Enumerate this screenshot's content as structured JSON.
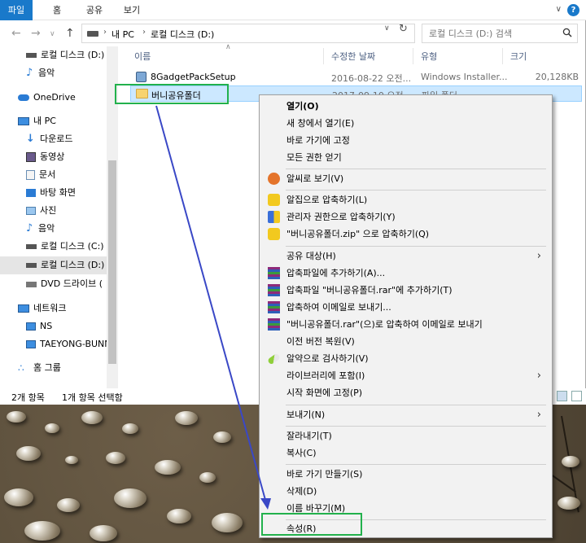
{
  "ribbon": {
    "tabs": [
      "파일",
      "홈",
      "공유",
      "보기"
    ],
    "help": "?"
  },
  "address": {
    "crumbs": [
      "내 PC",
      "로컬 디스크 (D:)"
    ],
    "search_placeholder": "로컬 디스크 (D:) 검색"
  },
  "nav": {
    "items": [
      {
        "label": "로컬 디스크 (D:)",
        "icon": "drive-icon"
      },
      {
        "label": "음악",
        "icon": "music-icon"
      },
      {
        "label": "OneDrive",
        "icon": "onedrive-icon"
      },
      {
        "label": "내 PC",
        "icon": "pc-icon"
      },
      {
        "label": "다운로드",
        "icon": "download-icon"
      },
      {
        "label": "동영상",
        "icon": "video-icon"
      },
      {
        "label": "문서",
        "icon": "document-icon"
      },
      {
        "label": "바탕 화면",
        "icon": "desktop-icon"
      },
      {
        "label": "사진",
        "icon": "picture-icon"
      },
      {
        "label": "음악",
        "icon": "music-icon"
      },
      {
        "label": "로컬 디스크 (C:)",
        "icon": "drive-icon"
      },
      {
        "label": "로컬 디스크 (D:)",
        "icon": "drive-icon"
      },
      {
        "label": "DVD 드라이브 (",
        "icon": "dvd-icon"
      },
      {
        "label": "네트워크",
        "icon": "network-icon"
      },
      {
        "label": "NS",
        "icon": "computer-icon"
      },
      {
        "label": "TAEYONG-BUNN",
        "icon": "computer-icon"
      },
      {
        "label": "홈 그룹",
        "icon": "homegroup-icon"
      }
    ]
  },
  "columns": {
    "name": "이름",
    "modified": "수정한 날짜",
    "type": "유형",
    "size": "크기"
  },
  "files": [
    {
      "name": "8GadgetPackSetup",
      "modified": "2016-08-22 오전...",
      "type": "Windows Installer...",
      "size": "20,128KB"
    },
    {
      "name": "버니공유폴더",
      "modified": "2017-09-10 오전...",
      "type": "파일 폴더",
      "size": ""
    }
  ],
  "status": {
    "count": "2개 항목",
    "selected": "1개 항목 선택함"
  },
  "menu": {
    "open": "열기(O)",
    "open_new": "새 창에서 열기(E)",
    "pin_quick": "바로 가기에 고정",
    "restore_all": "모든 권한 얻기",
    "alsee": "알씨로 보기(V)",
    "alzip": "알집으로 압축하기(L)",
    "admin_zip": "관리자 권한으로 압축하기(Y)",
    "zip_to": "\"버니공유폴더.zip\" 으로 압축하기(Q)",
    "share": "공유 대상(H)",
    "rar_add": "압축파일에 추가하기(A)...",
    "rar_add_named": "압축파일 \"버니공유폴더.rar\"에 추가하기(T)",
    "rar_email": "압축하여 이메일로 보내기...",
    "rar_email_named": "\"버니공유폴더.rar\"(으)로 압축하여 이메일로 보내기",
    "prev_version": "이전 버전 복원(V)",
    "alyac": "알약으로 검사하기(V)",
    "library": "라이브러리에 포함(I)",
    "pin_start": "시작 화면에 고정(P)",
    "send_to": "보내기(N)",
    "cut": "잘라내기(T)",
    "copy": "복사(C)",
    "shortcut": "바로 가기 만들기(S)",
    "delete": "삭제(D)",
    "rename": "이름 바꾸기(M)",
    "properties": "속성(R)"
  },
  "colors": {
    "accent": "#1979ca",
    "highlight_box": "#22b14c",
    "annotation_arrow": "#3a48c6",
    "selection": "#cce8ff"
  }
}
